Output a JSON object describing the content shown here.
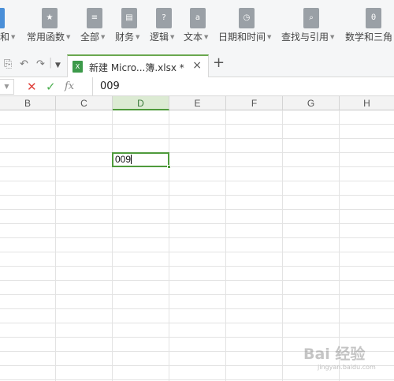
{
  "ribbon": {
    "items": [
      {
        "icon": "autosum-icon",
        "label": "和"
      },
      {
        "icon": "star-icon",
        "label": "常用函数"
      },
      {
        "icon": "list-icon",
        "label": "全部"
      },
      {
        "icon": "finance-icon",
        "label": "财务"
      },
      {
        "icon": "logic-icon",
        "label": "逻辑"
      },
      {
        "icon": "text-icon",
        "label": "文本"
      },
      {
        "icon": "clock-icon",
        "label": "日期和时间"
      },
      {
        "icon": "lookup-icon",
        "label": "查找与引用"
      },
      {
        "icon": "math-icon",
        "label": "数学和三角"
      }
    ],
    "glyphs": [
      "",
      "★",
      "≡",
      "▤",
      "?",
      "a",
      "◷",
      "⌕",
      "θ"
    ]
  },
  "tabs": {
    "active_title": "新建 Micro...簿.xlsx *",
    "close_glyph": "×",
    "add_glyph": "+"
  },
  "formula_bar": {
    "cancel_glyph": "✕",
    "enter_glyph": "✓",
    "fx_label": "fx",
    "value": "009"
  },
  "sheet": {
    "columns": [
      "B",
      "C",
      "D",
      "E",
      "F",
      "G",
      "H"
    ],
    "active_column": "D",
    "active_cell_value": "009"
  },
  "watermark": {
    "line1": "Bai 经验",
    "line2": "jingyan.baidu.com"
  },
  "colors": {
    "accent": "#4f9a3c",
    "cancel": "#e0413b",
    "confirm": "#4caf50"
  }
}
